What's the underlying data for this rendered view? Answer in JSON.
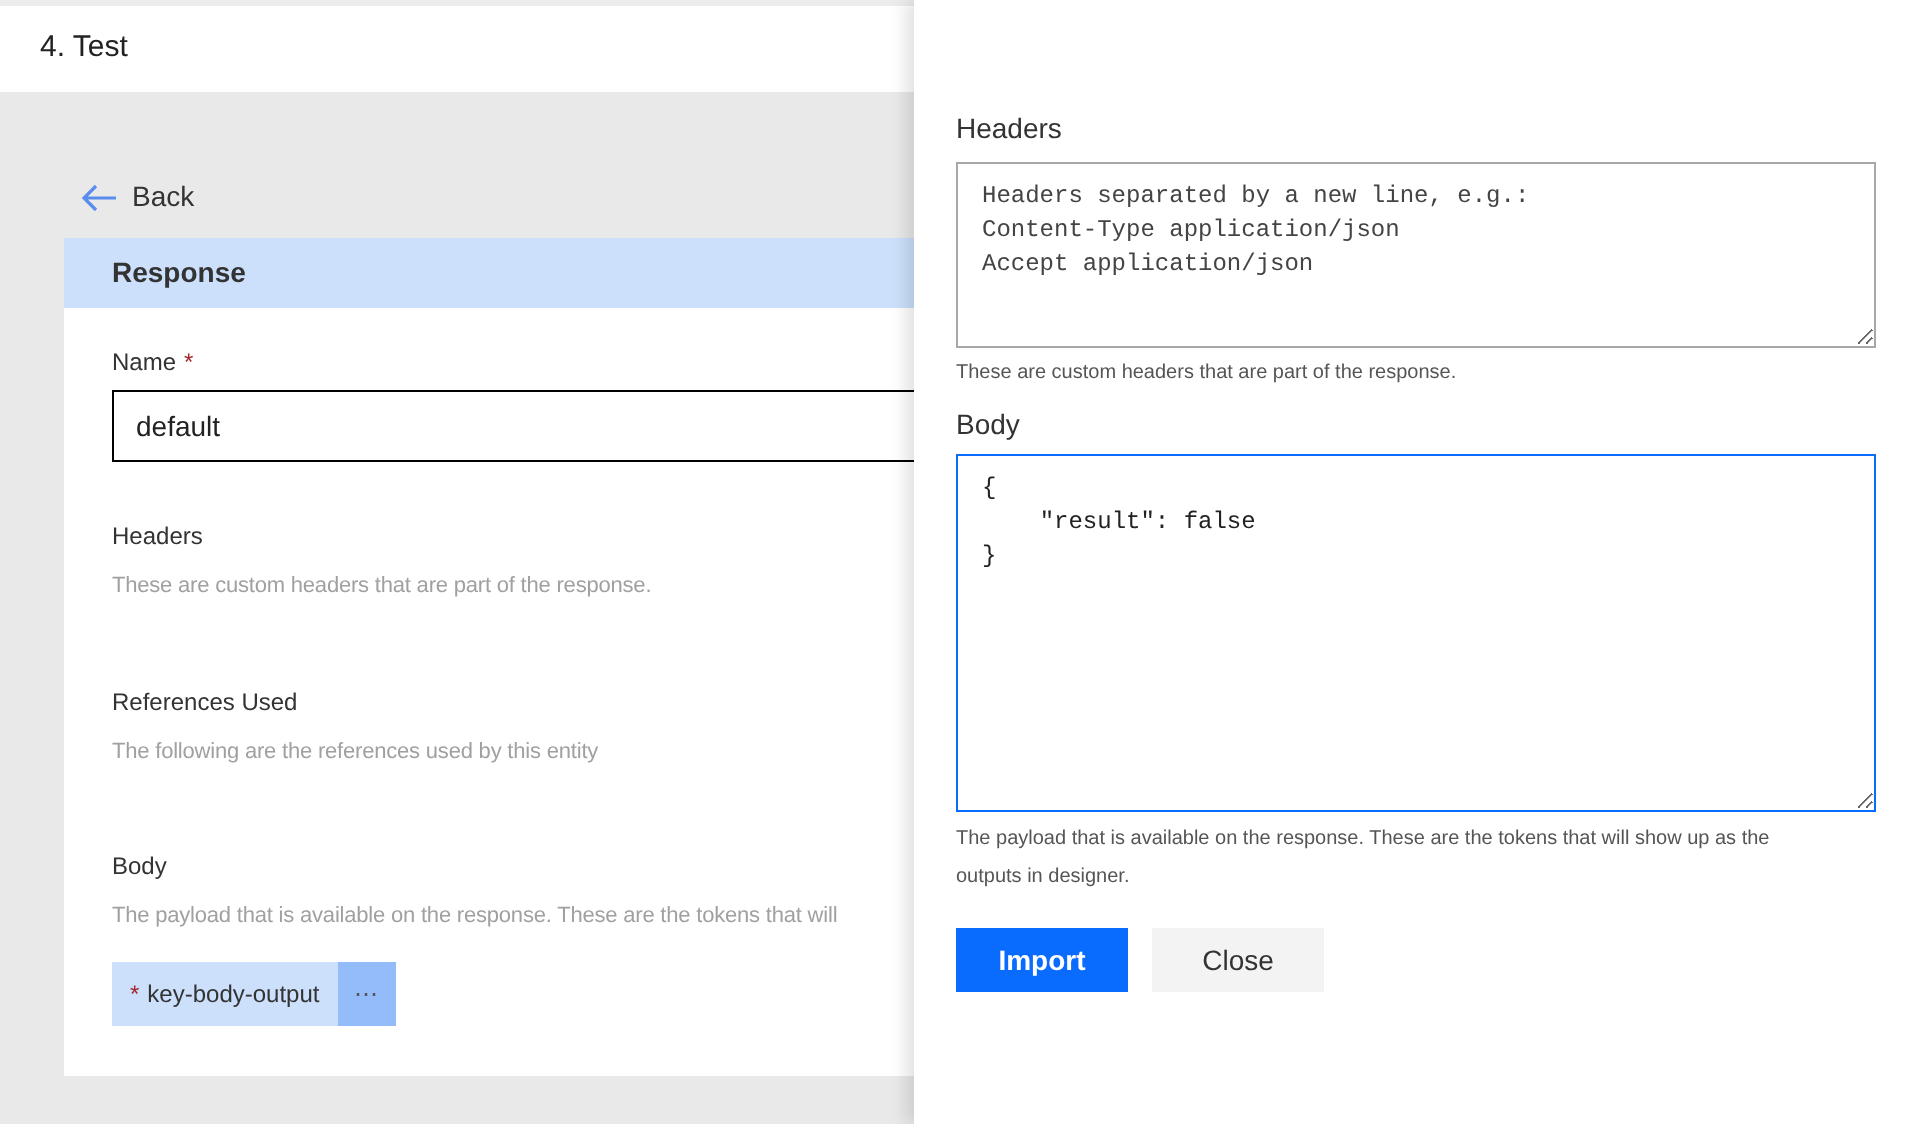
{
  "page": {
    "title": "4. Test",
    "back": "Back"
  },
  "card": {
    "title": "Response",
    "name_field": {
      "label": "Name",
      "required_mark": "*",
      "value": "default"
    },
    "sections": [
      {
        "label": "Headers",
        "description": "These are custom headers that are part of the response."
      },
      {
        "label": "References Used",
        "description": "The following are the references used by this entity"
      },
      {
        "label": "Body",
        "description": "The payload that is available on the response. These are the tokens that will"
      }
    ],
    "tokens": [
      {
        "label": "key-body-output",
        "required_mark": "*",
        "more": "⋯"
      }
    ]
  },
  "panel": {
    "headers": {
      "label": "Headers",
      "placeholder": "Headers separated by a new line, e.g.:\nContent-Type application/json\nAccept application/json",
      "help": "These are custom headers that are part of the response."
    },
    "body": {
      "label": "Body",
      "value": "{\n    \"result\": false\n}",
      "focused": true,
      "help": "The payload that is available on the response. These are the tokens that will show up as the outputs in designer."
    },
    "buttons": [
      {
        "label": "Import",
        "kind": "primary"
      },
      {
        "label": "Close",
        "kind": "secondary"
      }
    ]
  }
}
